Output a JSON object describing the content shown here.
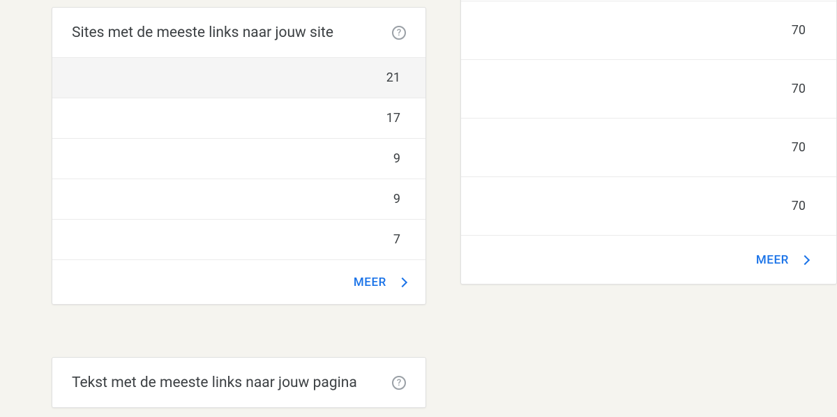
{
  "left_card_sites": {
    "title": "Sites met de meeste links naar jouw site",
    "rows": [
      {
        "value": "21"
      },
      {
        "value": "17"
      },
      {
        "value": "9"
      },
      {
        "value": "9"
      },
      {
        "value": "7"
      }
    ],
    "more_label": "MEER"
  },
  "left_card_text": {
    "title": "Tekst met de meeste links naar jouw pagina"
  },
  "right_card": {
    "rows": [
      {
        "value": "70"
      },
      {
        "value": "70"
      },
      {
        "value": "70"
      },
      {
        "value": "70"
      }
    ],
    "more_label": "MEER"
  },
  "help_glyph": "?"
}
